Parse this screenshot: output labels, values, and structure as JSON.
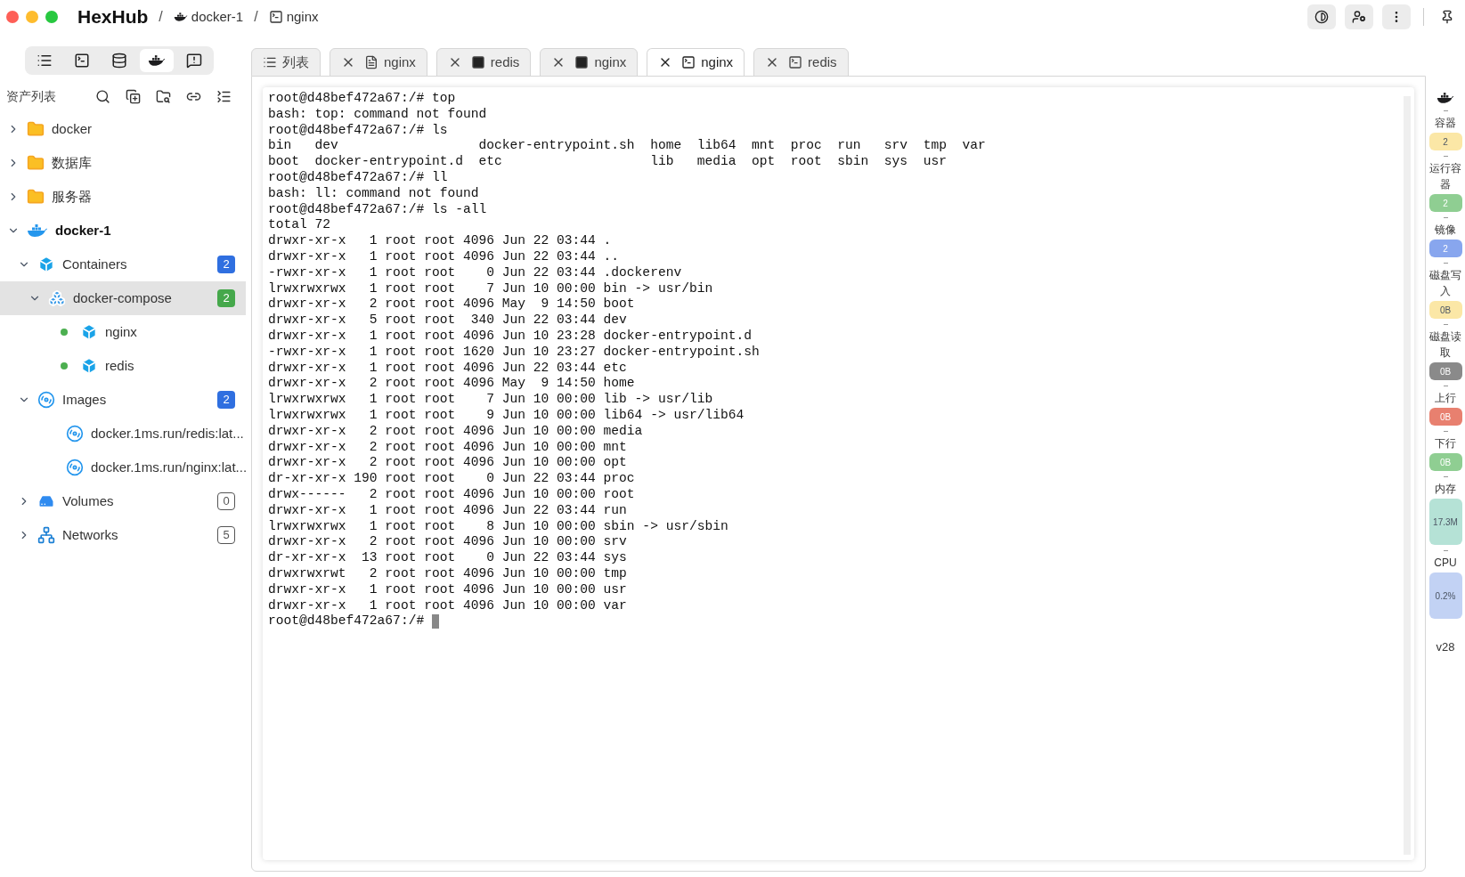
{
  "app": {
    "name": "HexHub"
  },
  "breadcrumb": [
    {
      "separator": "/",
      "label": "docker-1",
      "kind": "docker"
    },
    {
      "separator": "/",
      "label": "nginx",
      "kind": "terminal"
    }
  ],
  "sidebar": {
    "modes": [
      {
        "kind": "list",
        "selected": false
      },
      {
        "kind": "terminal",
        "selected": false
      },
      {
        "kind": "database",
        "selected": false
      },
      {
        "kind": "docker",
        "selected": true
      },
      {
        "kind": "monitor",
        "selected": false
      }
    ],
    "title": "资产列表",
    "tree": [
      {
        "label": "docker",
        "kind": "folder",
        "expanded": false,
        "selected": false
      },
      {
        "label": "数据库",
        "kind": "folder",
        "expanded": false,
        "selected": false
      },
      {
        "label": "服务器",
        "kind": "folder",
        "expanded": false,
        "selected": false
      },
      {
        "label": "docker-1",
        "kind": "docker",
        "expanded": true,
        "selected": false,
        "children": [
          {
            "label": "Containers",
            "kind": "containers",
            "expanded": true,
            "selected": false,
            "badge": {
              "text": "2",
              "color": "#2f6fe0",
              "outlined": false
            },
            "children": [
              {
                "label": "docker-compose",
                "kind": "compose",
                "expanded": true,
                "selected": true,
                "badge": {
                  "text": "2",
                  "color": "#45a84b",
                  "outlined": false
                },
                "children": [
                  {
                    "label": "nginx",
                    "kind": "container",
                    "running": true,
                    "selected": false
                  },
                  {
                    "label": "redis",
                    "kind": "container",
                    "running": true,
                    "selected": false
                  }
                ]
              }
            ]
          },
          {
            "label": "Images",
            "kind": "images",
            "expanded": true,
            "selected": false,
            "badge": {
              "text": "2",
              "color": "#2f6fe0",
              "outlined": false
            },
            "children": [
              {
                "label": "docker.1ms.run/redis:lat...",
                "kind": "image",
                "selected": false
              },
              {
                "label": "docker.1ms.run/nginx:lat...",
                "kind": "image",
                "selected": false
              }
            ]
          },
          {
            "label": "Volumes",
            "kind": "volumes",
            "expanded": false,
            "selected": false,
            "badge": {
              "text": "0",
              "color": "#555555",
              "outlined": true
            }
          },
          {
            "label": "Networks",
            "kind": "networks",
            "expanded": false,
            "selected": false,
            "badge": {
              "text": "5",
              "color": "#555555",
              "outlined": true
            }
          }
        ]
      }
    ]
  },
  "tabs": [
    {
      "label": "列表",
      "kind": "list",
      "closable": false,
      "selected": false
    },
    {
      "label": "nginx",
      "kind": "file",
      "closable": true,
      "selected": false
    },
    {
      "label": "redis",
      "kind": "container",
      "closable": true,
      "selected": false
    },
    {
      "label": "nginx",
      "kind": "container",
      "closable": true,
      "selected": false
    },
    {
      "label": "nginx",
      "kind": "terminal",
      "closable": true,
      "selected": true
    },
    {
      "label": "redis",
      "kind": "terminal",
      "closable": true,
      "selected": false
    }
  ],
  "terminal": {
    "lines": [
      "root@d48bef472a67:/# top",
      "bash: top: command not found",
      "root@d48bef472a67:/# ls",
      "bin   dev                  docker-entrypoint.sh  home  lib64  mnt  proc  run   srv  tmp  var",
      "boot  docker-entrypoint.d  etc                   lib   media  opt  root  sbin  sys  usr",
      "root@d48bef472a67:/# ll",
      "bash: ll: command not found",
      "root@d48bef472a67:/# ls -all",
      "total 72",
      "drwxr-xr-x   1 root root 4096 Jun 22 03:44 .",
      "drwxr-xr-x   1 root root 4096 Jun 22 03:44 ..",
      "-rwxr-xr-x   1 root root    0 Jun 22 03:44 .dockerenv",
      "lrwxrwxrwx   1 root root    7 Jun 10 00:00 bin -> usr/bin",
      "drwxr-xr-x   2 root root 4096 May  9 14:50 boot",
      "drwxr-xr-x   5 root root  340 Jun 22 03:44 dev",
      "drwxr-xr-x   1 root root 4096 Jun 10 23:28 docker-entrypoint.d",
      "-rwxr-xr-x   1 root root 1620 Jun 10 23:27 docker-entrypoint.sh",
      "drwxr-xr-x   1 root root 4096 Jun 22 03:44 etc",
      "drwxr-xr-x   2 root root 4096 May  9 14:50 home",
      "lrwxrwxrwx   1 root root    7 Jun 10 00:00 lib -> usr/lib",
      "lrwxrwxrwx   1 root root    9 Jun 10 00:00 lib64 -> usr/lib64",
      "drwxr-xr-x   2 root root 4096 Jun 10 00:00 media",
      "drwxr-xr-x   2 root root 4096 Jun 10 00:00 mnt",
      "drwxr-xr-x   2 root root 4096 Jun 10 00:00 opt",
      "dr-xr-xr-x 190 root root    0 Jun 22 03:44 proc",
      "drwx------   2 root root 4096 Jun 10 00:00 root",
      "drwxr-xr-x   1 root root 4096 Jun 22 03:44 run",
      "lrwxrwxrwx   1 root root    8 Jun 10 00:00 sbin -> usr/sbin",
      "drwxr-xr-x   2 root root 4096 Jun 10 00:00 srv",
      "dr-xr-xr-x  13 root root    0 Jun 22 03:44 sys",
      "drwxrwxrwt   2 root root 4096 Jun 10 00:00 tmp",
      "drwxr-xr-x   1 root root 4096 Jun 10 00:00 usr",
      "drwxr-xr-x   1 root root 4096 Jun 10 00:00 var"
    ],
    "prompt": "root@d48bef472a67:/# "
  },
  "stats": [
    {
      "label": "容器",
      "value": "2",
      "color": "#fbe7a6",
      "kind": "small"
    },
    {
      "label": "运行容器",
      "value": "2",
      "color": "#8fce92",
      "kind": "small"
    },
    {
      "label": "镜像",
      "value": "2",
      "color": "#88a6ee",
      "kind": "small"
    },
    {
      "label": "磁盘写入",
      "value": "0B",
      "color": "#fbe7a6",
      "kind": "small"
    },
    {
      "label": "磁盘读取",
      "value": "0B",
      "color": "#8a8a8a",
      "kind": "small"
    },
    {
      "label": "上行",
      "value": "0B",
      "color": "#e8806f",
      "kind": "small"
    },
    {
      "label": "下行",
      "value": "0B",
      "color": "#8fce92",
      "kind": "small"
    },
    {
      "label": "内存",
      "value": "17.3M",
      "color": "#b5e2d6",
      "kind": "tall"
    },
    {
      "label": "CPU",
      "value": "0.2%",
      "color": "#c2d2f4",
      "kind": "tall"
    }
  ],
  "version": "v28"
}
